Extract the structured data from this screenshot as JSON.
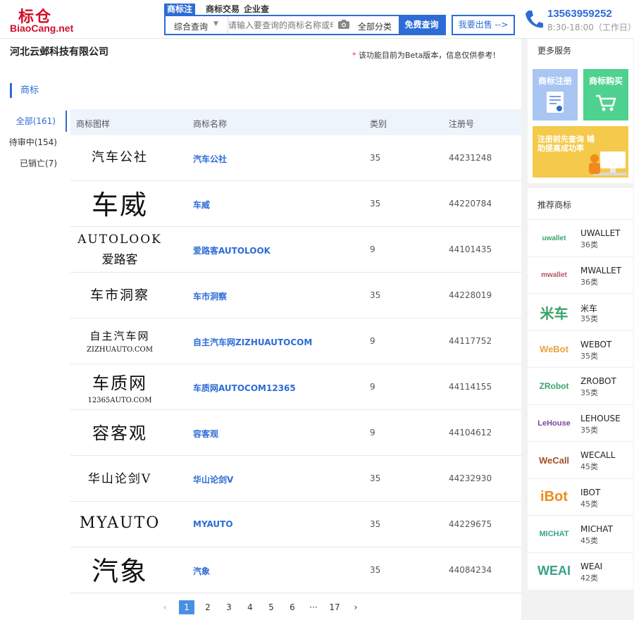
{
  "header": {
    "logo_cn": "标仓",
    "logo_en": "BiaoCang.net",
    "search_tabs": [
      "商标注",
      "商标交易",
      "企业查"
    ],
    "search_mode": "综合查询",
    "search_placeholder": "请输入要查询的商标名称或申",
    "search_category": "全部分类",
    "search_button": "免费查询",
    "sell_button": "我要出售 -->",
    "phone": "13563959252",
    "hours": "8:30-18:00（工作日）",
    "accent": "#2d6cd6",
    "brand": "#d0102a"
  },
  "company": "河北云邺科技有限公司",
  "beta_note": "该功能目前为Beta版本，信息仅供参考!",
  "section_title": "商标",
  "filters": [
    "全部(161)",
    "待审中(154)",
    "已销亡(7)"
  ],
  "table": {
    "headers": [
      "商标图样",
      "商标名称",
      "类别",
      "注册号"
    ],
    "rows": [
      {
        "img_main": "汽车公社",
        "img_sub": "",
        "name": "汽车公社",
        "cls": "35",
        "reg": "44231248"
      },
      {
        "img_main": "车威",
        "img_sub": "",
        "name": "车威",
        "cls": "35",
        "reg": "44220784"
      },
      {
        "img_main": "AUTOLOOK",
        "img_sub": "爱路客",
        "name": "爱路客AUTOLOOK",
        "cls": "9",
        "reg": "44101435"
      },
      {
        "img_main": "车市洞察",
        "img_sub": "",
        "name": "车市洞察",
        "cls": "35",
        "reg": "44228019"
      },
      {
        "img_main": "自主汽车网",
        "img_sub": "ZIZHUAUTO.COM",
        "name": "自主汽车网ZIZHUAUTOCOM",
        "cls": "9",
        "reg": "44117752"
      },
      {
        "img_main": "车质网",
        "img_sub": "12365AUTO.COM",
        "name": "车质网AUTOCOM12365",
        "cls": "9",
        "reg": "44114155"
      },
      {
        "img_main": "容客观",
        "img_sub": "",
        "name": "容客观",
        "cls": "9",
        "reg": "44104612"
      },
      {
        "img_main": "华山论剑V",
        "img_sub": "",
        "name": "华山论剑V",
        "cls": "35",
        "reg": "44232930"
      },
      {
        "img_main": "MYAUTO",
        "img_sub": "",
        "name": "MYAUTO",
        "cls": "35",
        "reg": "44229675"
      },
      {
        "img_main": "汽象",
        "img_sub": "",
        "name": "汽象",
        "cls": "35",
        "reg": "44084234"
      }
    ]
  },
  "pager": {
    "prev": "‹",
    "pages": [
      "1",
      "2",
      "3",
      "4",
      "5",
      "6",
      "···",
      "17"
    ],
    "next": "›",
    "current": "1"
  },
  "sidebar": {
    "more_title": "更多服务",
    "card_register": "商标注册",
    "card_buy": "商标购买",
    "banner": "注册前先查询 辅助提高成功率",
    "rec_title": "推荐商标",
    "rec_items": [
      {
        "logo": "uwallet",
        "name": "UWALLET",
        "cls": "36类",
        "color": "#3aa36a"
      },
      {
        "logo": "mwallet",
        "name": "MWALLET",
        "cls": "36类",
        "color": "#b0566a"
      },
      {
        "logo": "米车",
        "name": "米车",
        "cls": "35类",
        "color": "#3aa36a"
      },
      {
        "logo": "WeBot",
        "name": "WEBOT",
        "cls": "35类",
        "color": "#e8a33a"
      },
      {
        "logo": "ZRobot",
        "name": "ZROBOT",
        "cls": "35类",
        "color": "#3aa36a"
      },
      {
        "logo": "LeHouse",
        "name": "LEHOUSE",
        "cls": "35类",
        "color": "#7a4aa0"
      },
      {
        "logo": "WeCall",
        "name": "WECALL",
        "cls": "45类",
        "color": "#a0522d"
      },
      {
        "logo": "iBot",
        "name": "IBOT",
        "cls": "45类",
        "color": "#f08a1c"
      },
      {
        "logo": "MICHAT",
        "name": "MICHAT",
        "cls": "45类",
        "color": "#3aa08a"
      },
      {
        "logo": "WEAI",
        "name": "WEAI",
        "cls": "42类",
        "color": "#3aa08a"
      }
    ]
  }
}
